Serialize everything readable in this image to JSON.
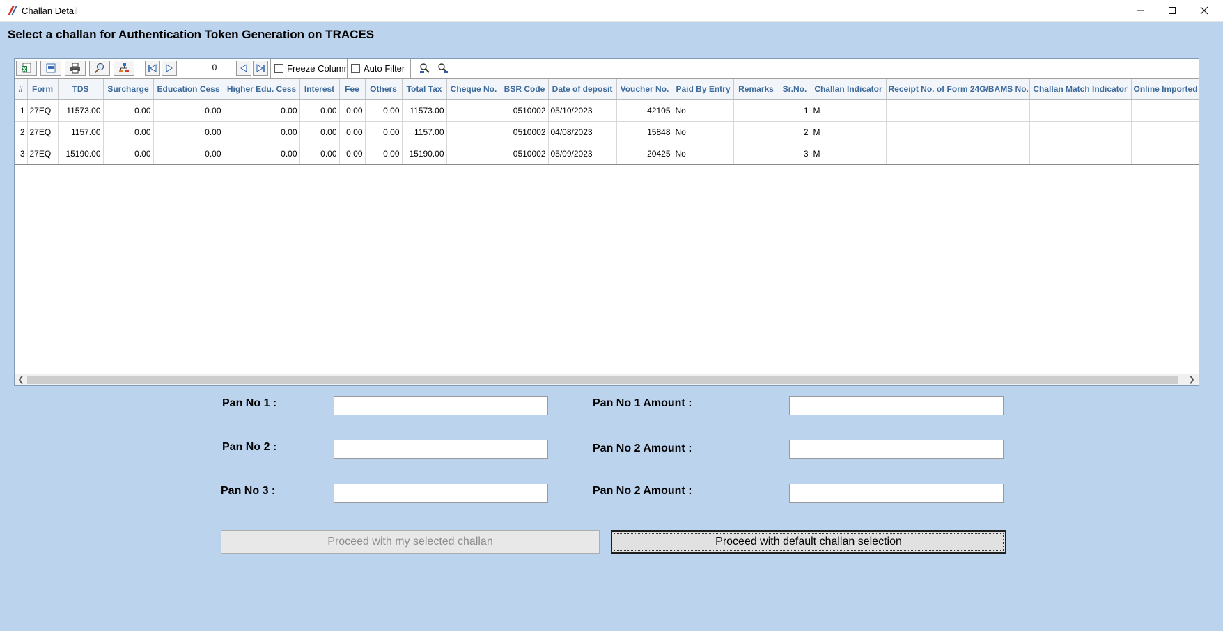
{
  "window": {
    "title": "Challan Detail",
    "controls": [
      "minimize",
      "maximize",
      "close"
    ]
  },
  "heading": "Select a challan for Authentication Token Generation on TRACES",
  "toolbar": {
    "record_count": "0",
    "freeze_column_label": "Freeze Column",
    "freeze_column_checked": false,
    "auto_filter_label": "Auto Filter",
    "auto_filter_checked": false
  },
  "table": {
    "columns": [
      "#",
      "Form",
      "TDS",
      "Surcharge",
      "Education Cess",
      "Higher Edu. Cess",
      "Interest",
      "Fee",
      "Others",
      "Total Tax",
      "Cheque No.",
      "BSR Code",
      "Date of deposit",
      "Voucher No.",
      "Paid By Entry",
      "Remarks",
      "Sr.No.",
      "Challan Indicator",
      "Receipt No. of Form 24G/BAMS No.",
      "Challan Match Indicator",
      "Online Imported"
    ],
    "rows": [
      [
        "1",
        "27EQ",
        "11573.00",
        "0.00",
        "0.00",
        "0.00",
        "0.00",
        "0.00",
        "0.00",
        "11573.00",
        "",
        "0510002",
        "05/10/2023",
        "42105",
        "No",
        "",
        "1",
        "M",
        "",
        "",
        ""
      ],
      [
        "2",
        "27EQ",
        "1157.00",
        "0.00",
        "0.00",
        "0.00",
        "0.00",
        "0.00",
        "0.00",
        "1157.00",
        "",
        "0510002",
        "04/08/2023",
        "15848",
        "No",
        "",
        "2",
        "M",
        "",
        "",
        ""
      ],
      [
        "3",
        "27EQ",
        "15190.00",
        "0.00",
        "0.00",
        "0.00",
        "0.00",
        "0.00",
        "0.00",
        "15190.00",
        "",
        "0510002",
        "05/09/2023",
        "20425",
        "No",
        "",
        "3",
        "M",
        "",
        "",
        ""
      ]
    ]
  },
  "form": {
    "pan1_label": "Pan No 1 :",
    "pan2_label": "Pan No 2 :",
    "pan3_label": "Pan No 3 :",
    "pan1_amount_label": "Pan No 1 Amount :",
    "pan2_amount_label": "Pan No 2 Amount :",
    "pan3_amount_label": "Pan No 2 Amount :",
    "pan1_value": "",
    "pan2_value": "",
    "pan3_value": "",
    "pan1_amount_value": "",
    "pan2_amount_value": "",
    "pan3_amount_value": ""
  },
  "buttons": {
    "proceed_selected": "Proceed with my selected challan",
    "proceed_default": "Proceed with default challan selection"
  },
  "colors": {
    "background": "#bcd3ee",
    "header_text": "#3f6b9b"
  }
}
